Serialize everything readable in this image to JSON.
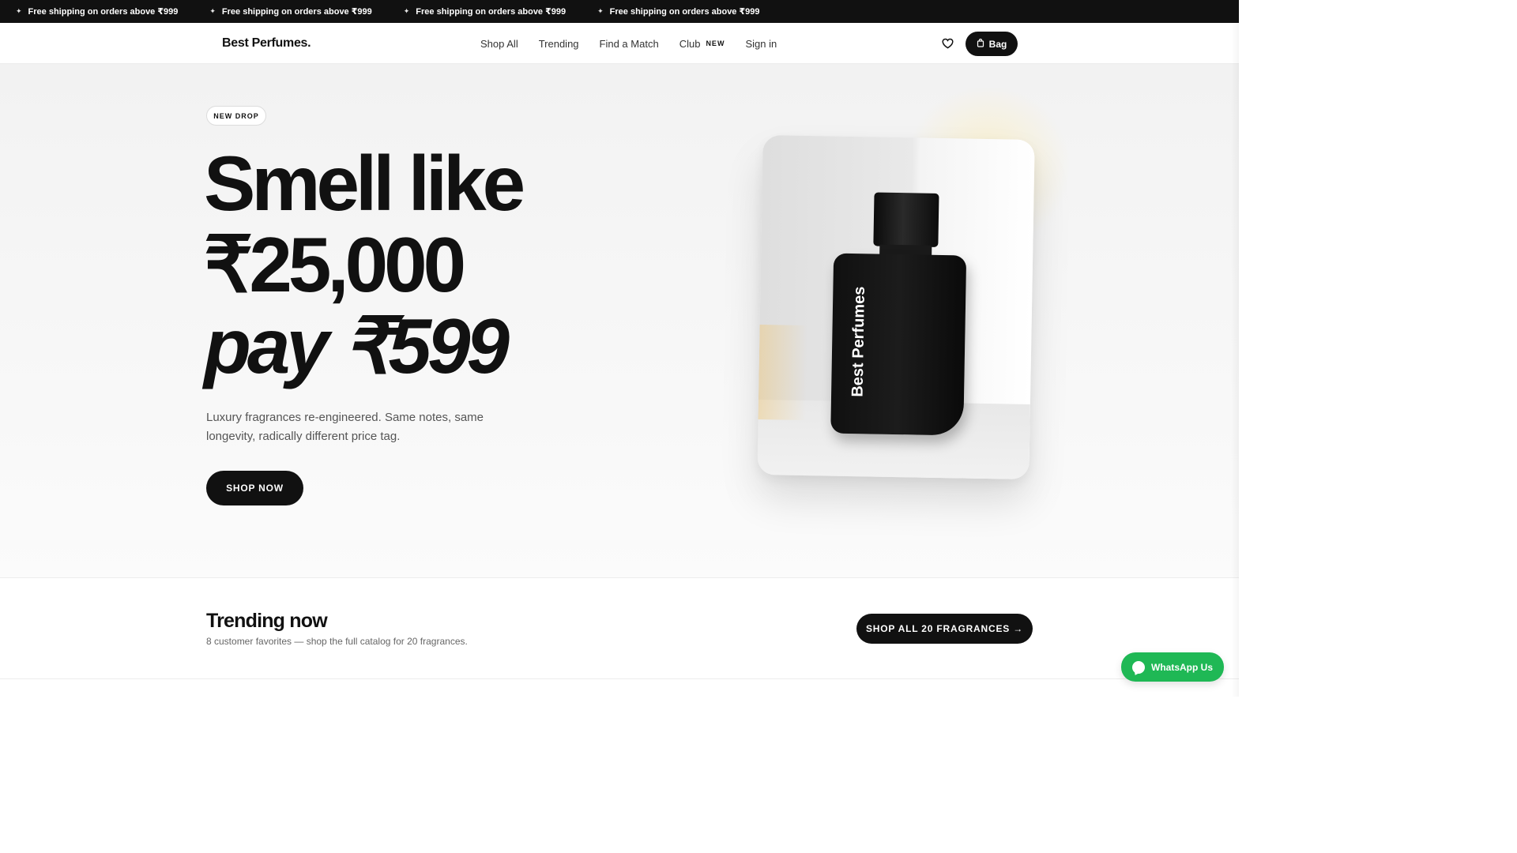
{
  "announcement": {
    "items": [
      "Free shipping on orders above ₹999",
      "Free shipping on orders above ₹999",
      "Free shipping on orders above ₹999",
      "Free shipping on orders above ₹999"
    ],
    "star_icon": "sparkle-icon"
  },
  "header": {
    "logo": "Best Perfumes.",
    "nav": {
      "shop_all": "Shop All",
      "trending": "Trending",
      "find_match": "Find a Match",
      "club": "Club",
      "club_badge": "NEW",
      "sign_in": "Sign in"
    },
    "wishlist_icon": "heart-icon",
    "bag_label": "Bag",
    "bag_icon": "bag-icon"
  },
  "hero": {
    "badge": "NEW DROP",
    "headline_line1": "Smell like",
    "headline_line2": "₹25,000",
    "headline_line3": "pay ₹599",
    "subtext": "Luxury fragrances re-engineered. Same notes, same longevity, radically different price tag.",
    "cta": "SHOP NOW",
    "bottle_label": "Best Perfumes"
  },
  "trending": {
    "title": "Trending now",
    "subtitle": "8 customer favorites — shop the full catalog for 20 fragrances.",
    "cta": "SHOP ALL 20 FRAGRANCES →"
  },
  "whatsapp": {
    "label": "WhatsApp Us",
    "icon": "whatsapp-icon"
  },
  "colors": {
    "primary": "#111111",
    "whatsapp": "#1fb855",
    "background": "#f5f5f5"
  }
}
